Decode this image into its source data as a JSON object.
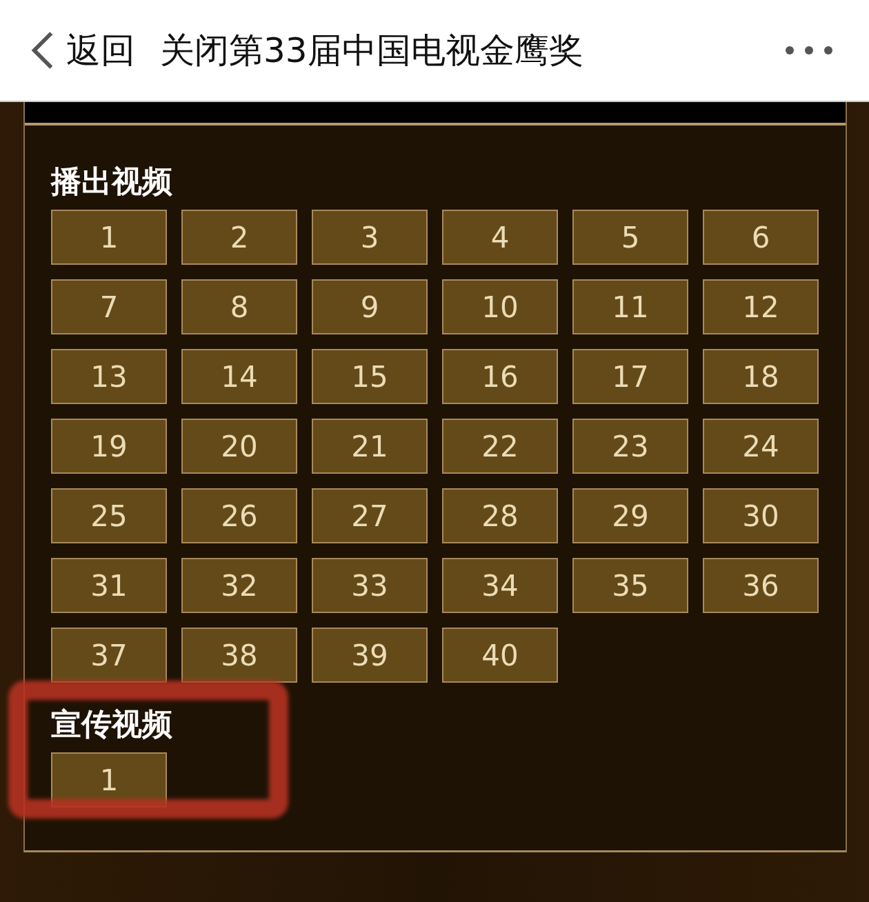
{
  "header": {
    "back_label": "返回",
    "title": "关闭第33届中国电视金鹰奖"
  },
  "sections": [
    {
      "title": "播出视频",
      "highlighted": false,
      "episodes": [
        "1",
        "2",
        "3",
        "4",
        "5",
        "6",
        "7",
        "8",
        "9",
        "10",
        "11",
        "12",
        "13",
        "14",
        "15",
        "16",
        "17",
        "18",
        "19",
        "20",
        "21",
        "22",
        "23",
        "24",
        "25",
        "26",
        "27",
        "28",
        "29",
        "30",
        "31",
        "32",
        "33",
        "34",
        "35",
        "36",
        "37",
        "38",
        "39",
        "40"
      ]
    },
    {
      "title": "宣传视频",
      "highlighted": true,
      "episodes": [
        "1"
      ]
    }
  ]
}
